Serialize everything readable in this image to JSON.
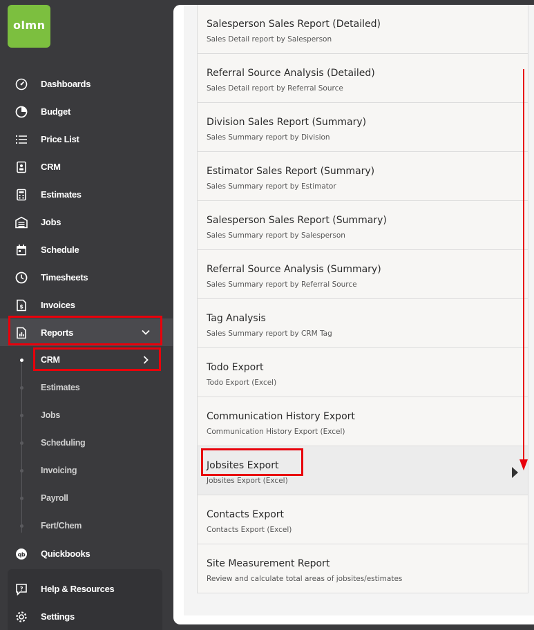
{
  "logo": {
    "text": "olmn"
  },
  "nav": [
    {
      "label": "Dashboards",
      "icon": "dashboard-gauge-icon"
    },
    {
      "label": "Budget",
      "icon": "pie-chart-icon"
    },
    {
      "label": "Price List",
      "icon": "list-icon"
    },
    {
      "label": "CRM",
      "icon": "contact-card-icon"
    },
    {
      "label": "Estimates",
      "icon": "calculator-icon"
    },
    {
      "label": "Jobs",
      "icon": "warehouse-icon"
    },
    {
      "label": "Schedule",
      "icon": "calendar-icon"
    },
    {
      "label": "Timesheets",
      "icon": "clock-icon"
    },
    {
      "label": "Invoices",
      "icon": "invoice-dollar-icon"
    },
    {
      "label": "Reports",
      "icon": "report-chart-icon"
    }
  ],
  "reports_sub": [
    {
      "label": "CRM",
      "active": true
    },
    {
      "label": "Estimates"
    },
    {
      "label": "Jobs"
    },
    {
      "label": "Scheduling"
    },
    {
      "label": "Invoicing"
    },
    {
      "label": "Payroll"
    },
    {
      "label": "Fert/Chem"
    }
  ],
  "quickbooks": {
    "label": "Quickbooks",
    "icon": "quickbooks-icon"
  },
  "help": {
    "label": "Help & Resources",
    "icon": "help-chat-icon"
  },
  "settings": {
    "label": "Settings",
    "icon": "gear-icon"
  },
  "reports": [
    {
      "title": "Salesperson Sales Report (Detailed)",
      "desc": "Sales Detail report by Salesperson"
    },
    {
      "title": "Referral Source Analysis (Detailed)",
      "desc": "Sales Detail report by Referral Source"
    },
    {
      "title": "Division Sales Report (Summary)",
      "desc": "Sales Summary report by Division"
    },
    {
      "title": "Estimator Sales Report (Summary)",
      "desc": "Sales Summary report by Estimator"
    },
    {
      "title": "Salesperson Sales Report (Summary)",
      "desc": "Sales Summary report by Salesperson"
    },
    {
      "title": "Referral Source Analysis (Summary)",
      "desc": "Sales Summary report by Referral Source"
    },
    {
      "title": "Tag Analysis",
      "desc": "Sales Summary report by CRM Tag"
    },
    {
      "title": "Todo Export",
      "desc": "Todo Export (Excel)"
    },
    {
      "title": "Communication History Export",
      "desc": "Communication History Export (Excel)"
    },
    {
      "title": "Jobsites Export",
      "desc": "Jobsites Export (Excel)"
    },
    {
      "title": "Contacts Export",
      "desc": "Contacts Export (Excel)"
    },
    {
      "title": "Site Measurement Report",
      "desc": "Review and calculate total areas of jobsites/estimates"
    }
  ],
  "colors": {
    "accent_green": "#7cbf3f",
    "highlight_red": "#e8000b",
    "sidebar_bg": "#3a3a3d"
  }
}
